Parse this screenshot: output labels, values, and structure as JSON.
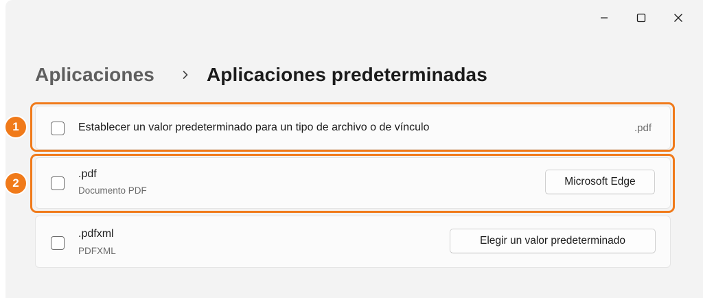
{
  "window": {
    "controls": {
      "minimize_icon": "minimize-icon",
      "maximize_icon": "maximize-icon",
      "close_icon": "close-icon"
    }
  },
  "breadcrumb": {
    "parent": "Aplicaciones",
    "separator_icon": "chevron-right-icon",
    "current": "Aplicaciones predeterminadas"
  },
  "rows": [
    {
      "text": "Establecer un valor predeterminado para un tipo de archivo o de vínculo",
      "value": ".pdf"
    },
    {
      "title": ".pdf",
      "subtitle": "Documento PDF",
      "button_label": "Microsoft Edge"
    },
    {
      "title": ".pdfxml",
      "subtitle": "PDFXML",
      "button_label": "Elegir un valor predeterminado"
    }
  ],
  "annotations": [
    {
      "number": "1"
    },
    {
      "number": "2"
    }
  ],
  "colors": {
    "highlight": "#f07a1a",
    "background": "#f3f3f3",
    "card": "#fbfbfb"
  }
}
